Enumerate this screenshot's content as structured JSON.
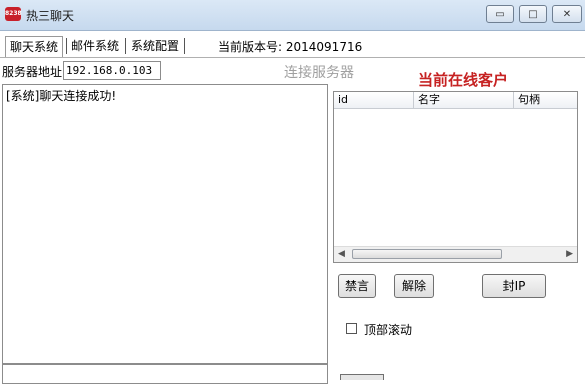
{
  "window": {
    "title": "热三聊天",
    "icon_text": "8238",
    "controls": {
      "minimize": "▭",
      "maximize": "□",
      "close": "✕"
    }
  },
  "tabs": [
    {
      "label": "聊天系统",
      "active": true
    },
    {
      "label": "邮件系统",
      "active": false
    },
    {
      "label": "系统配置",
      "active": false
    }
  ],
  "version": {
    "label": "当前版本号:",
    "value": "2014091716"
  },
  "server": {
    "label": "服务器地址",
    "address": "192.168.0.103",
    "connect_label": "连接服务器"
  },
  "chat": {
    "log": "[系统]聊天连接成功!"
  },
  "online": {
    "title": "当前在线客户",
    "columns": [
      "id",
      "名字",
      "句柄"
    ],
    "rows": []
  },
  "actions": {
    "mute": "禁言",
    "unmute": "解除",
    "ban_ip": "封IP"
  },
  "options": {
    "scroll_top_label": "顶部滚动",
    "scroll_top_checked": false
  },
  "colors": {
    "online_title": "#c62222",
    "connect_disabled": "#a0a0a0"
  }
}
